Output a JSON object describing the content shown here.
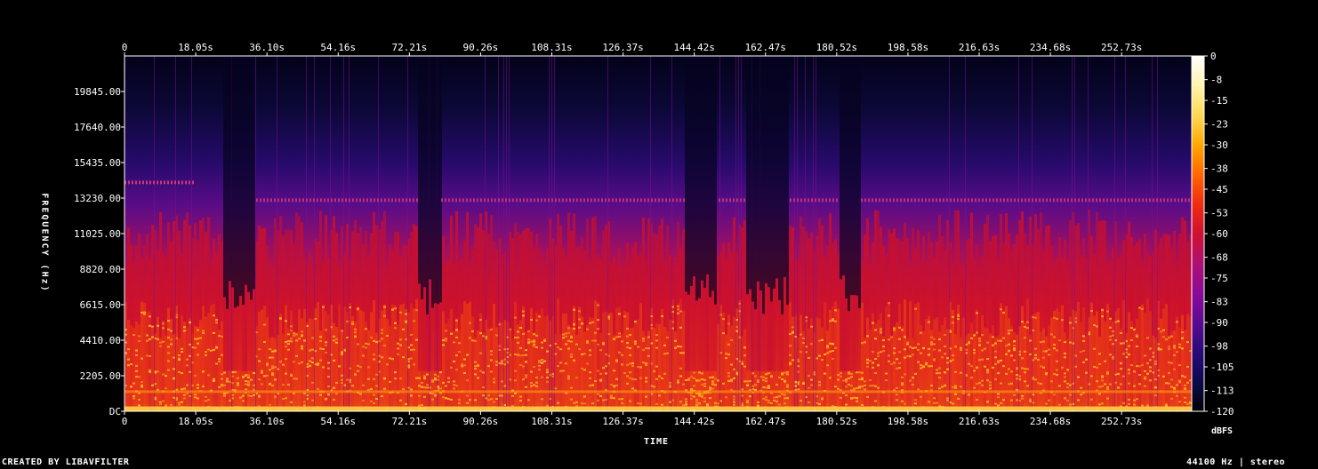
{
  "chart_data": {
    "type": "heatmap",
    "xlabel": "TIME",
    "ylabel": "FREQUENCY (Hz)",
    "x_ticks": [
      "0",
      "18.05s",
      "36.10s",
      "54.16s",
      "72.21s",
      "90.26s",
      "108.31s",
      "126.37s",
      "144.42s",
      "162.47s",
      "180.52s",
      "198.58s",
      "216.63s",
      "234.68s",
      "252.73s"
    ],
    "x_tick_values": [
      0,
      18.05,
      36.1,
      54.16,
      72.21,
      90.26,
      108.31,
      126.37,
      144.42,
      162.47,
      180.52,
      198.58,
      216.63,
      234.68,
      252.73
    ],
    "x_max_seconds": 270.5,
    "y_ticks": [
      "DC",
      "2205.00",
      "4410.00",
      "6615.00",
      "8820.00",
      "11025.00",
      "13230.00",
      "15435.00",
      "17640.00",
      "19845.00"
    ],
    "y_tick_values": [
      0,
      2205,
      4410,
      6615,
      8820,
      11025,
      13230,
      15435,
      17640,
      19845
    ],
    "y_max_hz": 22050,
    "colorbar_unit": "dBFS",
    "colorbar_ticks": [
      "0",
      "-8",
      "-15",
      "-23",
      "-30",
      "-38",
      "-45",
      "-53",
      "-60",
      "-68",
      "-75",
      "-83",
      "-90",
      "-98",
      "-105",
      "-113",
      "-120"
    ],
    "colorbar_range": [
      -120,
      0
    ],
    "colormap": [
      "#000000",
      "#0a0a4a",
      "#2a0a7a",
      "#5a0a90",
      "#8a0a9a",
      "#b01070",
      "#d01030",
      "#ee2a10",
      "#ff6a00",
      "#ffa800",
      "#ffd850",
      "#fff4b0",
      "#ffffff"
    ]
  },
  "footer": {
    "left": "CREATED BY LIBAVFILTER",
    "right": "44100 Hz | stereo"
  }
}
